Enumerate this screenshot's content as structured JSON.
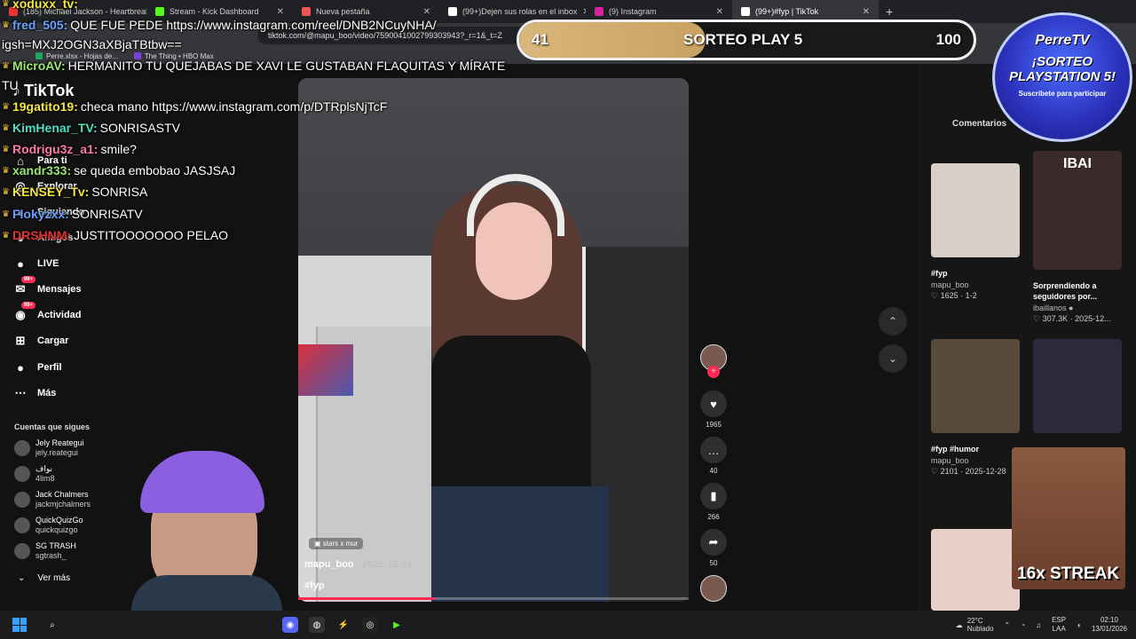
{
  "browser": {
    "tabs": [
      {
        "label": "(185) Michael Jackson - Heartbreak",
        "color": "#e33"
      },
      {
        "label": "Stream - Kick Dashboard",
        "color": "#53fc18"
      },
      {
        "label": "Nueva pestaña",
        "color": "#e55"
      },
      {
        "label": "(99+)Dejen sus rolas en el inbox",
        "color": "#fff"
      },
      {
        "label": "(9) Instagram",
        "color": "#d6249f"
      },
      {
        "label": "(99+)#fyp | TikTok",
        "color": "#fff",
        "active": true
      }
    ],
    "url": "tiktok.com/@mapu_boo/video/7590041002799303943?_r=1&_t=Z",
    "bookmarks": [
      "Perre.xlsx - Hojas de...",
      "The Thing • HBO Max"
    ]
  },
  "sidebar": {
    "logo": "TikTok",
    "nav": [
      {
        "label": "Para ti",
        "icon": "home-icon",
        "glyph": "⌂"
      },
      {
        "label": "Explorar",
        "icon": "compass-icon",
        "glyph": "◎"
      },
      {
        "label": "Siguiendo",
        "icon": "following-icon",
        "glyph": "●"
      },
      {
        "label": "Amigos",
        "icon": "friends-icon",
        "glyph": "●"
      },
      {
        "label": "LIVE",
        "icon": "live-icon",
        "glyph": "●"
      },
      {
        "label": "Mensajes",
        "icon": "messages-icon",
        "glyph": "✉",
        "badge": "99+"
      },
      {
        "label": "Actividad",
        "icon": "activity-icon",
        "glyph": "◉",
        "badge": "99+"
      },
      {
        "label": "Cargar",
        "icon": "upload-icon",
        "glyph": "⊞"
      },
      {
        "label": "Perfil",
        "icon": "profile-icon",
        "glyph": "●"
      },
      {
        "label": "Más",
        "icon": "more-icon",
        "glyph": "⋯"
      }
    ],
    "following_title": "Cuentas que sigues",
    "following": [
      {
        "name": "Jely Reategui",
        "user": "jely.reategui"
      },
      {
        "name": "نواف",
        "user": "4lim8"
      },
      {
        "name": "Jack Chalmers",
        "user": "jackmjchalmers"
      },
      {
        "name": "QuickQuizGo",
        "user": "quickquizgo"
      },
      {
        "name": "SG TRASH",
        "user": "sgtrash_"
      }
    ],
    "see_more": "Ver más"
  },
  "video": {
    "tag": "stars x mur",
    "author": "mapu_boo",
    "date": "· 2025-12-31",
    "hashtag": "#fyp",
    "progress": 0.35
  },
  "rail": {
    "likes": "1965",
    "comments": "40",
    "saves": "266",
    "shares": "50"
  },
  "right": {
    "comments_tab": "Comentarios",
    "cards": [
      {
        "title": "#fyp",
        "author": "mapu_boo",
        "stats": "♡ 1625 · 1-2",
        "bg": "#d8d0c8"
      },
      {
        "title": "Sorprendiendo a seguidores por...",
        "author": "ibaillanos ●",
        "stats": "♡ 307.3K · 2025-12...",
        "bg": "#3a2a2a",
        "overlay": "IBAI"
      },
      {
        "title": "#fyp #humor",
        "author": "mapu_boo",
        "stats": "♡ 2101 · 2025-12-28",
        "bg": "#5a4a3a"
      },
      {
        "title": "",
        "author": "",
        "stats": "",
        "bg": "#2a2a3a"
      },
      {
        "title": "",
        "author": "",
        "stats": "",
        "bg": "#e8d0c8"
      }
    ]
  },
  "chat": [
    {
      "nick": "xoduxx_tv:",
      "msg": "",
      "color": "#f5e642"
    },
    {
      "nick": "fred_505:",
      "msg": "QUE FUE PEDE https://www.instagram.com/reel/DNB2NCuyNHA/",
      "color": "#6aa0ff"
    },
    {
      "nick": "",
      "msg": "igsh=MXJ2OGN3aXBjaTBtbw==",
      "color": "#fff"
    },
    {
      "nick": "MicroAV:",
      "msg": "HERMANITO TU QUEJABAS DE XAVI LE GUSTABAN FLAQUITAS Y MÍRATE",
      "color": "#9be870"
    },
    {
      "nick": "",
      "msg": "TU",
      "color": "#fff"
    },
    {
      "nick": "19gatito19:",
      "msg": "checa mano https://www.instagram.com/p/DTRplsNjTcF",
      "color": "#f5e642"
    },
    {
      "nick": "KimHenar_TV:",
      "msg": "SONRISASTV",
      "color": "#4de0c0"
    },
    {
      "nick": "Rodrigu3z_a1:",
      "msg": "smile?",
      "color": "#ff7aa8"
    },
    {
      "nick": "xandr333:",
      "msg": "se queda embobao JASJSAJ",
      "color": "#9be870"
    },
    {
      "nick": "KENSEY_Tv:",
      "msg": "SONRISA",
      "color": "#f5e642"
    },
    {
      "nick": "Flokyzxx:",
      "msg": "SONRISATV",
      "color": "#6aa0ff"
    },
    {
      "nick": "DRSHNM:",
      "msg": "JUSTITOOOOOOO PELAO",
      "color": "#e53030"
    }
  ],
  "raffle": {
    "left": "41",
    "title": "SORTEO PLAY 5",
    "right": "100",
    "fraction": 0.41
  },
  "promo": {
    "l1": "PerreTV",
    "l2": "¡SORTEO PLAYSTATION 5!",
    "l3": "Suscríbete para participar"
  },
  "streak": "16x STREAK",
  "taskbar": {
    "weather_temp": "22°C",
    "weather_desc": "Nublado",
    "lang": "ESP",
    "lang2": "LAA",
    "time": "02:10",
    "date": "13/01/2026"
  }
}
